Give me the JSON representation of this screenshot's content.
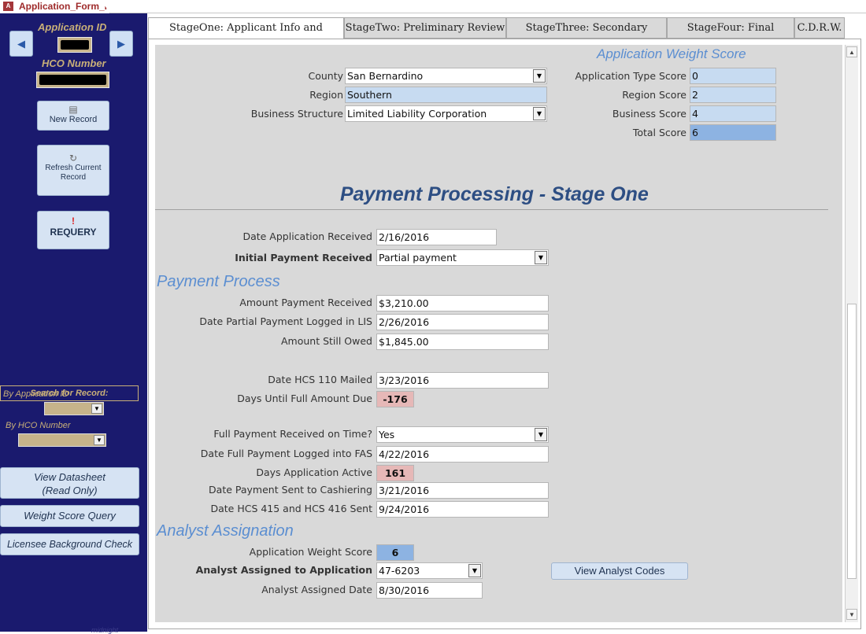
{
  "window": {
    "tab_title": "Application_Form_F"
  },
  "sidebar": {
    "application_id_label": "Application ID",
    "hco_number_label": "HCO Number",
    "new_record": "New Record",
    "refresh": "Refresh Current Record",
    "requery": "REQUERY",
    "search_title": "Search for Record:",
    "by_app_id": "By Application ID",
    "by_hco": "By HCO Number",
    "view_datasheet_l1": "View Datasheet",
    "view_datasheet_l2": "(Read Only)",
    "weight_score_query": "Weight Score Query",
    "licensee_check": "Licensee Background Check",
    "watermark": "midnight"
  },
  "tabs": [
    {
      "label": "StageOne: Applicant Info and Payment",
      "active": true
    },
    {
      "label": "StageTwo: Preliminary Review"
    },
    {
      "label": "StageThree: Secondary Review"
    },
    {
      "label": "StageFour: Final Review"
    },
    {
      "label": "C.D.R.W."
    }
  ],
  "top": {
    "county_label": "County",
    "county": "San Bernardino",
    "region_label": "Region",
    "region": "Southern",
    "business_label": "Business Structure",
    "business": "Limited Liability Corporation"
  },
  "weight": {
    "heading": "Application Weight Score",
    "app_type_label": "Application Type Score",
    "app_type": "0",
    "region_label": "Region Score",
    "region": "2",
    "business_label": "Business Score",
    "business": "4",
    "total_label": "Total Score",
    "total": "6"
  },
  "payment": {
    "title": "Payment Processing - Stage One",
    "date_received_label": "Date Application Received",
    "date_received": "2/16/2016",
    "initial_label": "Initial Payment Received",
    "initial": "Partial payment",
    "process_heading": "Payment Process",
    "amount_label": "Amount Payment Received",
    "amount": "$3,210.00",
    "partial_logged_label": "Date Partial Payment Logged in LIS",
    "partial_logged": "2/26/2016",
    "still_owed_label": "Amount Still Owed",
    "still_owed": "$1,845.00",
    "hcs110_label": "Date HCS 110 Mailed",
    "hcs110": "3/23/2016",
    "days_due_label": "Days Until Full Amount Due",
    "days_due": "-176",
    "full_ontime_label": "Full Payment Received on Time?",
    "full_ontime": "Yes",
    "full_logged_label": "Date Full Payment Logged into FAS",
    "full_logged": "4/22/2016",
    "days_active_label": "Days Application Active",
    "days_active": "161",
    "cashiering_label": "Date Payment Sent to Cashiering",
    "cashiering": "3/21/2016",
    "hcs415_label": "Date HCS 415 and HCS 416 Sent",
    "hcs415": "9/24/2016"
  },
  "analyst": {
    "heading": "Analyst Assignation",
    "weight_label": "Application Weight Score",
    "weight": "6",
    "assigned_label": "Analyst Assigned to Application",
    "assigned": "47-6203",
    "date_label": "Analyst Assigned Date",
    "date": "8/30/2016",
    "view_codes": "View Analyst Codes"
  }
}
